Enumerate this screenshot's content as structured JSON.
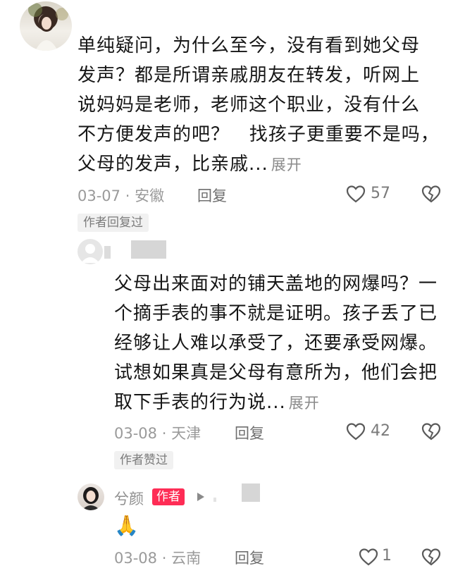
{
  "comment1": {
    "text_lines": [
      "单纯疑问，为什么至今，没有看到她父母",
      "发声？都是所谓亲戚朋友在转发，听网上",
      "说妈妈是老师，老师这个职业，没有什么",
      "不方便发声的吧？   找孩子更重要不是吗，",
      "父母的发声，比亲戚..."
    ],
    "expand_label": "展开",
    "date": "03-07",
    "dot": "·",
    "location": "安徽",
    "reply_label": "回复",
    "likes": "57",
    "tag": "作者回复过"
  },
  "comment2": {
    "text_lines": [
      "父母出来面对的铺天盖地的网爆吗？一",
      "个摘手表的事不就是证明。孩子丢了已",
      "经够让人难以承受了，还要承受网爆。",
      "试想如果真是父母有意所为，他们会把",
      "取下手表的行为说..."
    ],
    "expand_label": "展开",
    "date": "03-08",
    "dot": "·",
    "location": "天津",
    "reply_label": "回复",
    "likes": "42",
    "tag": "作者赞过"
  },
  "comment3": {
    "author_name": "兮颜",
    "author_badge": "作者",
    "text": "🙏",
    "date": "03-08",
    "dot": "·",
    "location": "云南",
    "reply_label": "回复",
    "likes": "1"
  },
  "colors": {
    "author_badge": "#fe2c55",
    "tag_bg": "#f1f1f1"
  },
  "icons": [
    "heart-icon",
    "broken-heart-icon",
    "play-arrow-icon"
  ]
}
